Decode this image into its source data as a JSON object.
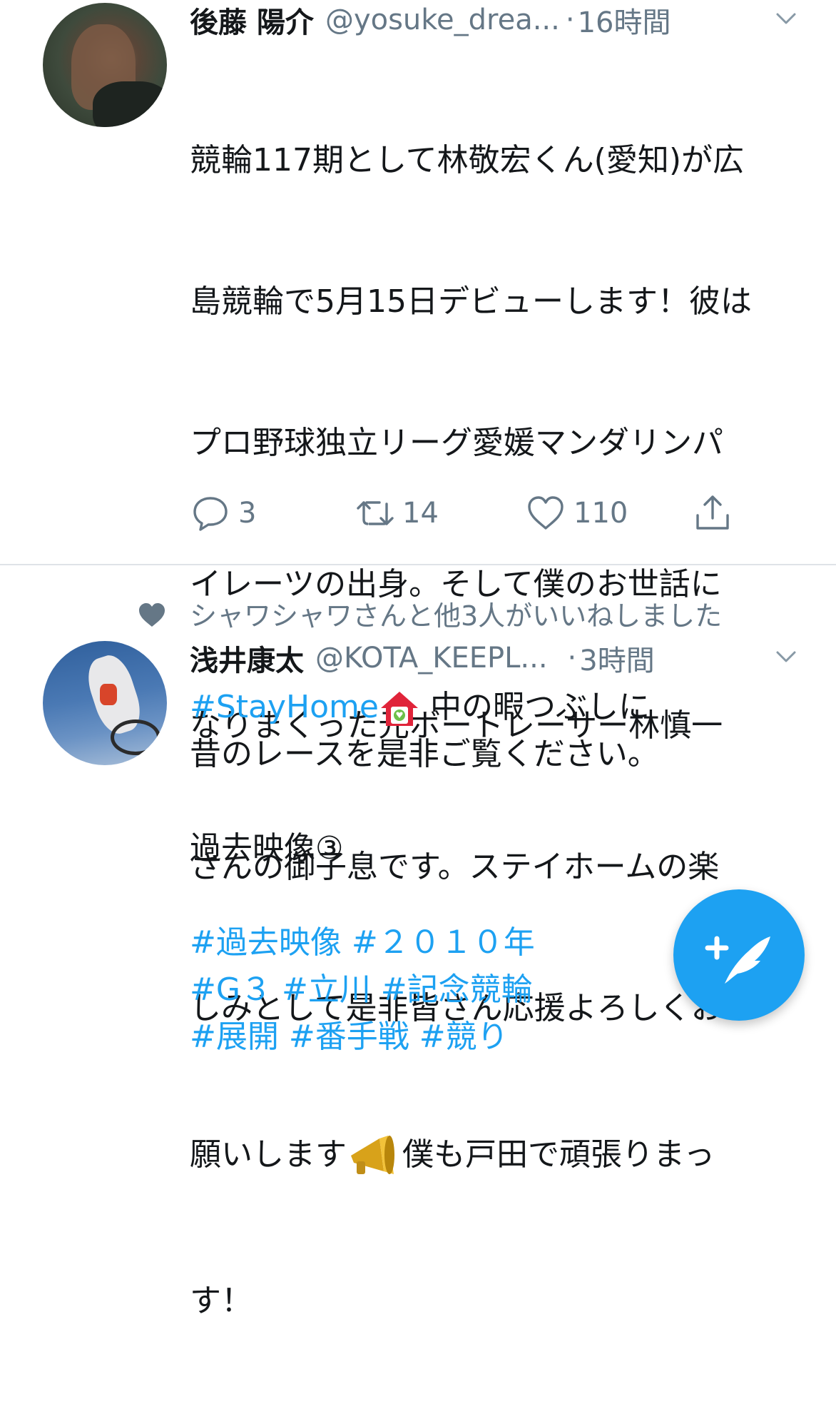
{
  "tweets": [
    {
      "name": "後藤 陽介",
      "handle": "@yosuke_drea...",
      "separator": "·",
      "time": "16時間",
      "lines": [
        "競輪117期として林敬宏くん(愛知)が広",
        "島競輪で5月15日デビューします！彼は",
        "プロ野球独立リーグ愛媛マンダリンパ",
        "イレーツの出身。そして僕のお世話に",
        "なりまくった元ボートレーサー林慎一",
        "さんの御子息です。ステイホームの楽",
        "しみとして是非皆さん応援よろしくお",
        "願いします",
        "僕も戸田で頑張りまっ",
        "す！"
      ],
      "emoji": "megaphone-icon",
      "actions": {
        "reply_count": "3",
        "retweet_count": "14",
        "like_count": "110"
      }
    },
    {
      "social_context": "シャワシャワさんと他3人がいいねしました",
      "name": "浅井康太",
      "handle": "@KOTA_KEEPL...",
      "separator": "·",
      "time": "3時間",
      "hashtag_stayhome": "#StayHome",
      "line1_rest": " 中の暇つぶしに",
      "line2": "昔のレースを是非ご覧ください。",
      "line3": "過去映像③",
      "tags_line1": "#過去映像 #２０１０年",
      "tags_line2": "#G３ #立川 #記念競輪",
      "tags_line3": "#展開 #番手戦 #競り",
      "emoji": "house-icon"
    }
  ],
  "colors": {
    "accent": "#1da1f2",
    "secondary_text": "#657786",
    "primary_text": "#14171a",
    "divider": "#dfe3e7"
  },
  "fab": {
    "icon": "compose-tweet-icon"
  }
}
